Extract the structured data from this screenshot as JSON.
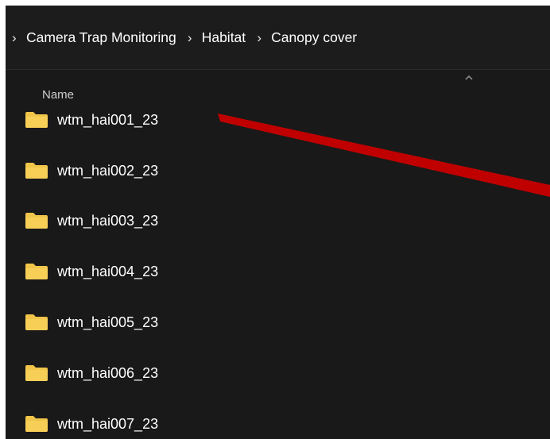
{
  "breadcrumb": {
    "separator": "›",
    "items": [
      {
        "label": "Camera Trap Monitoring"
      },
      {
        "label": "Habitat"
      },
      {
        "label": "Canopy cover"
      }
    ]
  },
  "list": {
    "column_header": "Name",
    "sort_icon": "chevron-up-icon",
    "items": [
      {
        "name": "wtm_hai001_23",
        "icon": "folder-icon"
      },
      {
        "name": "wtm_hai002_23",
        "icon": "folder-icon"
      },
      {
        "name": "wtm_hai003_23",
        "icon": "folder-icon"
      },
      {
        "name": "wtm_hai004_23",
        "icon": "folder-icon"
      },
      {
        "name": "wtm_hai005_23",
        "icon": "folder-icon"
      },
      {
        "name": "wtm_hai006_23",
        "icon": "folder-icon"
      },
      {
        "name": "wtm_hai007_23",
        "icon": "folder-icon"
      }
    ]
  },
  "colors": {
    "window_background": "#191919",
    "folder": "#f0c54a",
    "annotation": "#c00000"
  }
}
